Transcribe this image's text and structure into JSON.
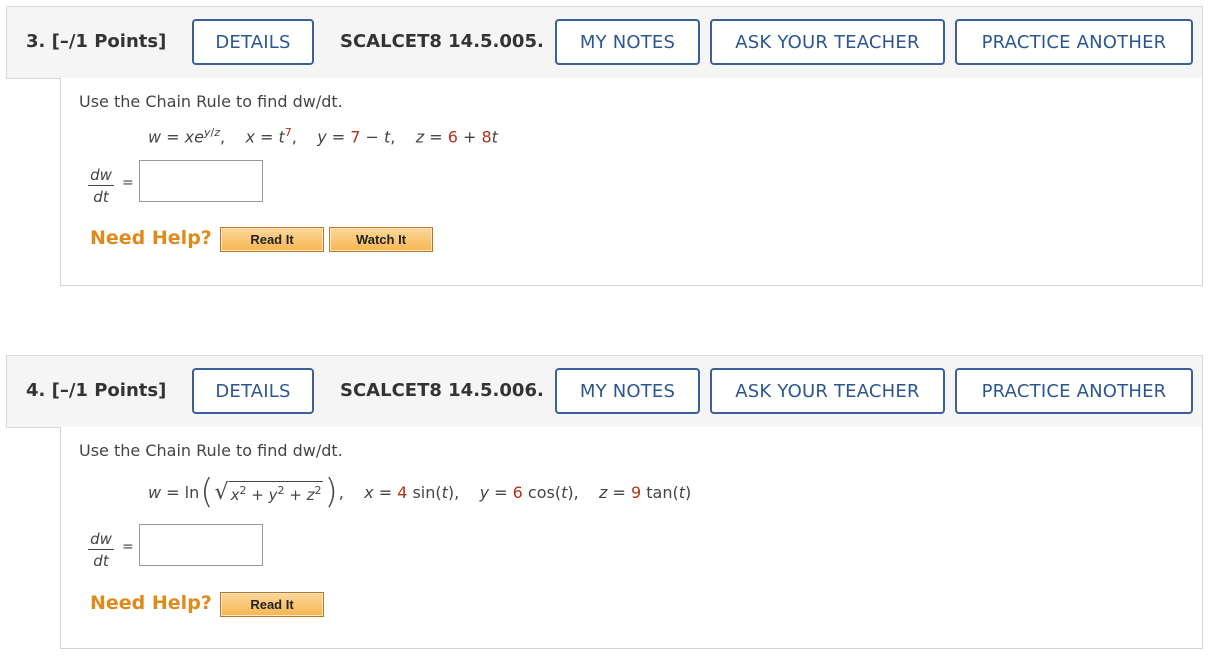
{
  "questions": [
    {
      "points": "3.  [–/1 Points]",
      "details_label": "DETAILS",
      "code": "SCALCET8 14.5.005.",
      "my_notes_label": "MY NOTES",
      "ask_teacher_label": "ASK YOUR TEACHER",
      "practice_label": "PRACTICE ANOTHER",
      "prompt": "Use the Chain Rule to find dw/dt.",
      "need_help": "Need Help?",
      "read_it": "Read It",
      "watch_it": "Watch It",
      "frac_num": "dw",
      "frac_den": "dt",
      "equals": "=",
      "answer_value": ""
    },
    {
      "points": "4.  [–/1 Points]",
      "details_label": "DETAILS",
      "code": "SCALCET8 14.5.006.",
      "my_notes_label": "MY NOTES",
      "ask_teacher_label": "ASK YOUR TEACHER",
      "practice_label": "PRACTICE ANOTHER",
      "prompt": "Use the Chain Rule to find dw/dt.",
      "need_help": "Need Help?",
      "read_it": "Read It",
      "frac_num": "dw",
      "frac_den": "dt",
      "equals": "=",
      "answer_value": ""
    }
  ],
  "colors": {
    "button_border": "#3a5f9a",
    "button_text": "#2b568f",
    "numeric_highlight": "#b0321b",
    "need_help": "#e08a1e"
  }
}
